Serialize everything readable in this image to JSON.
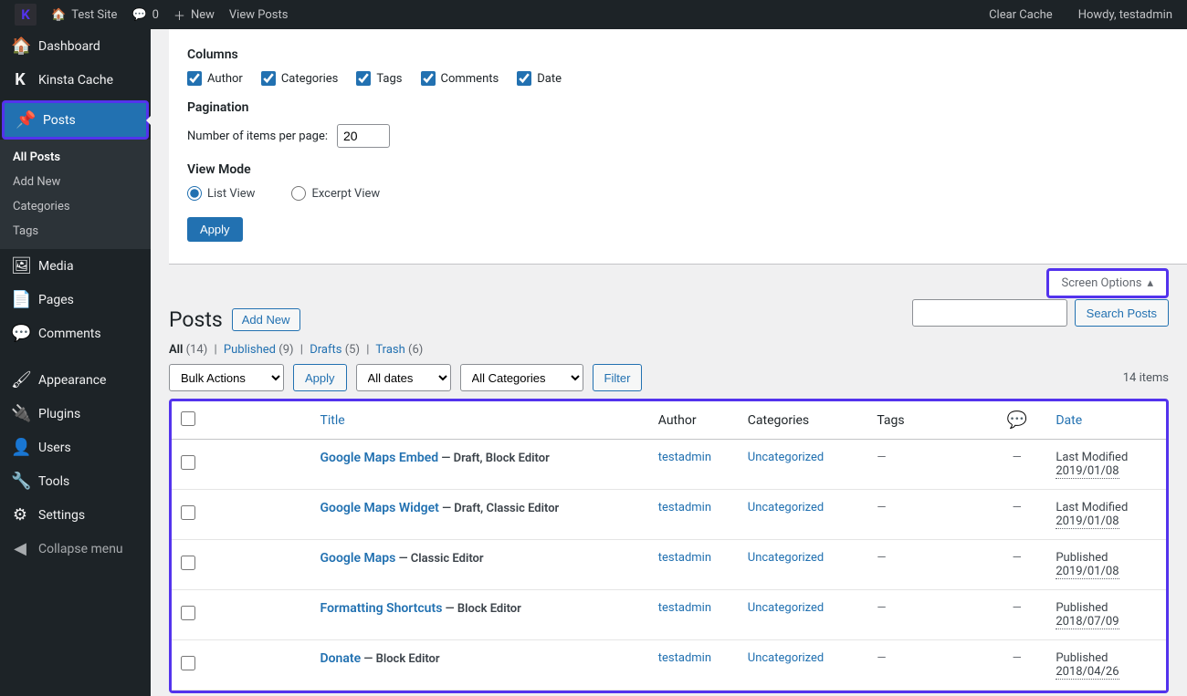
{
  "adminbar": {
    "site_name": "Test Site",
    "comment_count": "0",
    "new_label": "New",
    "view_posts": "View Posts",
    "clear_cache": "Clear Cache",
    "howdy": "Howdy, testadmin"
  },
  "sidebar": {
    "dashboard": "Dashboard",
    "kinsta": "Kinsta Cache",
    "posts": "Posts",
    "posts_sub": {
      "all": "All Posts",
      "add": "Add New",
      "cats": "Categories",
      "tags": "Tags"
    },
    "media": "Media",
    "pages": "Pages",
    "comments": "Comments",
    "appearance": "Appearance",
    "plugins": "Plugins",
    "users": "Users",
    "tools": "Tools",
    "settings": "Settings",
    "collapse": "Collapse menu"
  },
  "screen_options": {
    "columns_heading": "Columns",
    "cols": {
      "author": "Author",
      "categories": "Categories",
      "tags": "Tags",
      "comments": "Comments",
      "date": "Date"
    },
    "pagination_heading": "Pagination",
    "per_page_label": "Number of items per page:",
    "per_page_value": "20",
    "view_mode_heading": "View Mode",
    "list_view": "List View",
    "excerpt_view": "Excerpt View",
    "apply": "Apply",
    "tab_label": "Screen Options"
  },
  "page": {
    "title": "Posts",
    "add_new": "Add New"
  },
  "filters": {
    "all": "All",
    "all_count": "(14)",
    "published": "Published",
    "published_count": "(9)",
    "drafts": "Drafts",
    "drafts_count": "(5)",
    "trash": "Trash",
    "trash_count": "(6)",
    "bulk_actions": "Bulk Actions",
    "apply": "Apply",
    "all_dates": "All dates",
    "all_categories": "All Categories",
    "filter": "Filter",
    "items_count": "14 items",
    "search": "Search Posts"
  },
  "table": {
    "headers": {
      "title": "Title",
      "author": "Author",
      "categories": "Categories",
      "tags": "Tags",
      "date": "Date"
    },
    "rows": [
      {
        "title": "Google Maps Embed",
        "state": "— Draft, Block Editor",
        "author": "testadmin",
        "category": "Uncategorized",
        "tags": "—",
        "comments": "—",
        "date_status": "Last Modified",
        "date_value": "2019/01/08"
      },
      {
        "title": "Google Maps Widget",
        "state": "— Draft, Classic Editor",
        "author": "testadmin",
        "category": "Uncategorized",
        "tags": "—",
        "comments": "—",
        "date_status": "Last Modified",
        "date_value": "2019/01/08"
      },
      {
        "title": "Google Maps",
        "state": "— Classic Editor",
        "author": "testadmin",
        "category": "Uncategorized",
        "tags": "—",
        "comments": "—",
        "date_status": "Published",
        "date_value": "2019/01/08"
      },
      {
        "title": "Formatting Shortcuts",
        "state": "— Block Editor",
        "author": "testadmin",
        "category": "Uncategorized",
        "tags": "—",
        "comments": "—",
        "date_status": "Published",
        "date_value": "2018/07/09"
      },
      {
        "title": "Donate",
        "state": "— Block Editor",
        "author": "testadmin",
        "category": "Uncategorized",
        "tags": "—",
        "comments": "—",
        "date_status": "Published",
        "date_value": "2018/04/26"
      }
    ]
  }
}
